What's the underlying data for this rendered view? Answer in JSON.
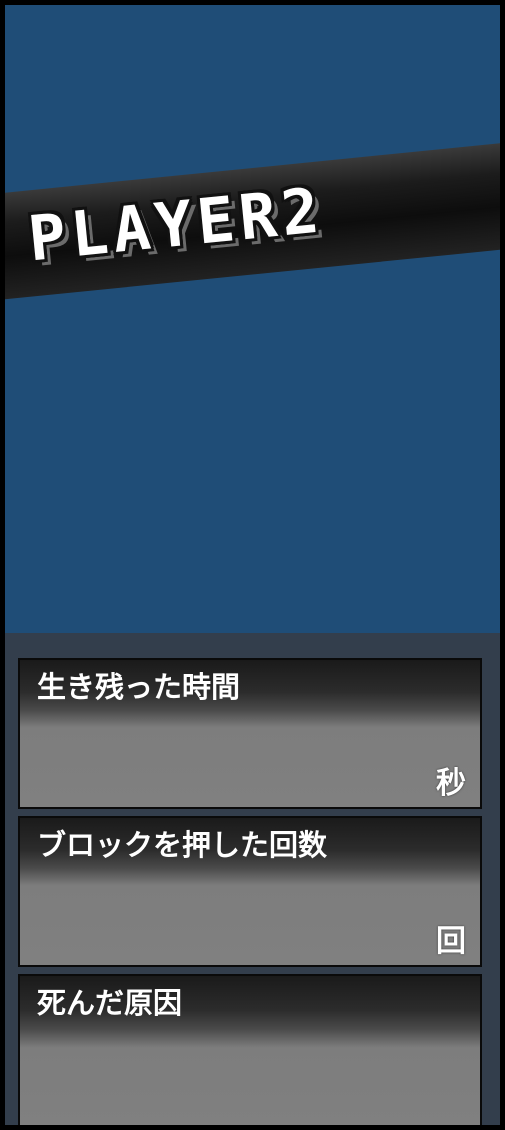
{
  "player": {
    "banner_text": "PLAYER2"
  },
  "stats": [
    {
      "label": "生き残った時間",
      "unit": "秒"
    },
    {
      "label": "ブロックを押した回数",
      "unit": "回"
    },
    {
      "label": "死んだ原因",
      "unit": ""
    }
  ],
  "colors": {
    "arena_background": "#1f4d77",
    "panel_background": "#333e4c",
    "banner": "#111111",
    "text": "#ffffff"
  }
}
